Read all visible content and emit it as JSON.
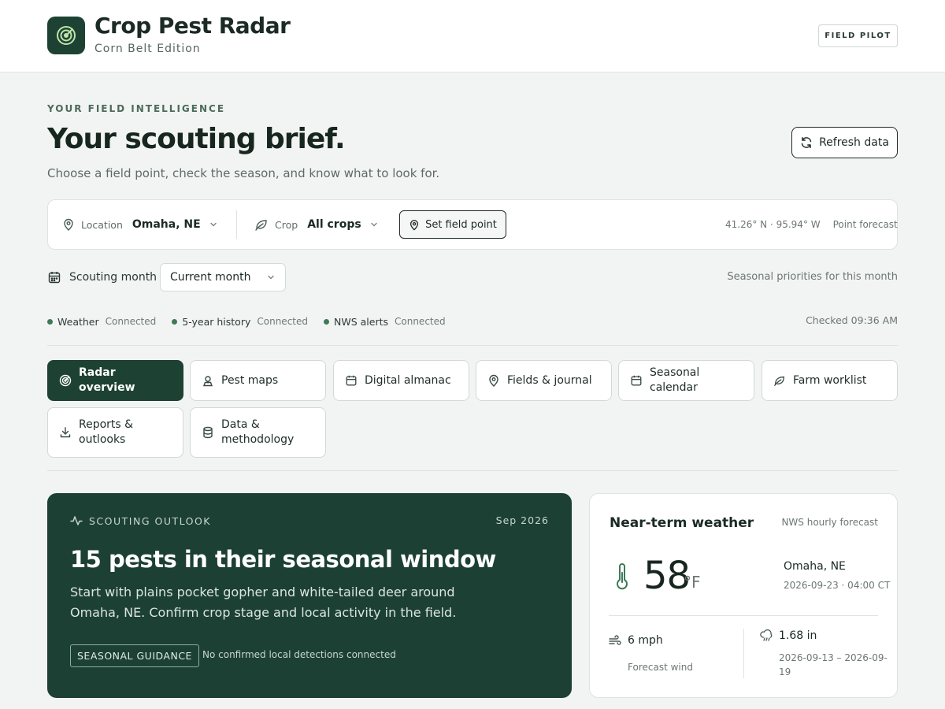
{
  "app": {
    "title": "Crop Pest Radar",
    "subtitle": "Corn Belt Edition",
    "badge": "FIELD PILOT"
  },
  "intro": {
    "eyebrow": "YOUR FIELD INTELLIGENCE",
    "heading": "Your scouting brief.",
    "lede": "Choose a field point, check the season, and know what to look for.",
    "refresh_label": "Refresh data"
  },
  "location_bar": {
    "location_key": "Location",
    "location_value": "Omaha, NE",
    "crop_key": "Crop",
    "crop_value": "All crops",
    "set_point_label": "Set field point",
    "coords": "41.26° N · 95.94° W",
    "forecast_type": "Point forecast"
  },
  "month": {
    "label": "Scouting month",
    "selected": "Current month",
    "note": "Seasonal priorities for this month"
  },
  "status": {
    "items": [
      {
        "name": "Weather",
        "value": "Connected"
      },
      {
        "name": "5-year history",
        "value": "Connected"
      },
      {
        "name": "NWS alerts",
        "value": "Connected"
      }
    ],
    "checked": "Checked 09:36 AM"
  },
  "tabs": [
    {
      "label": "Radar overview",
      "icon": "radar-icon",
      "active": true
    },
    {
      "label": "Pest maps",
      "icon": "map-pin-icon"
    },
    {
      "label": "Digital almanac",
      "icon": "calendar-icon"
    },
    {
      "label": "Fields & journal",
      "icon": "location-icon"
    },
    {
      "label": "Seasonal calendar",
      "icon": "calendar-icon"
    },
    {
      "label": "Farm worklist",
      "icon": "leaf-icon"
    },
    {
      "label": "Reports & outlooks",
      "icon": "download-icon"
    },
    {
      "label": "Data & methodology",
      "icon": "database-icon"
    }
  ],
  "outlook": {
    "kicker": "SCOUTING OUTLOOK",
    "date": "Sep 2026",
    "heading": "15 pests in their seasonal window",
    "body": "Start with plains pocket gopher and white-tailed deer around Omaha, NE. Confirm crop stage and local activity in the field.",
    "badge": "SEASONAL GUIDANCE",
    "note": "No confirmed local detections connected"
  },
  "weather": {
    "title": "Near-term weather",
    "source": "NWS hourly forecast",
    "temp": "58",
    "unit": "°F",
    "city": "Omaha, NE",
    "time": "2026-09-23 · 04:00 CT",
    "wind": "6 mph",
    "wind_label": "Forecast wind",
    "rain": "1.68 in",
    "rain_range": "2026-09-13 – 2026-09-19"
  },
  "colors": {
    "brand": "#1d4234",
    "accent": "#3e7a57"
  }
}
